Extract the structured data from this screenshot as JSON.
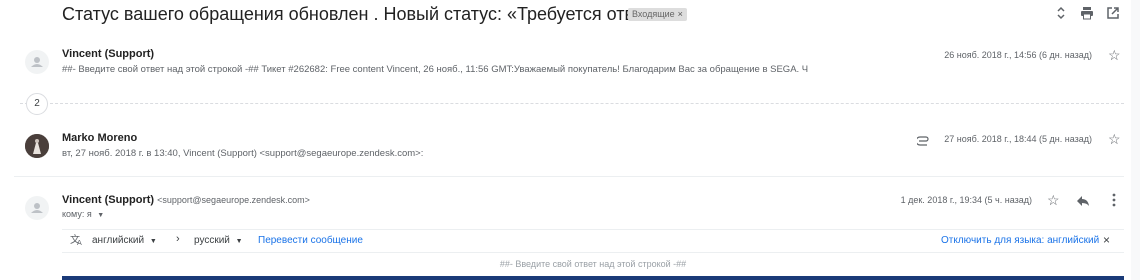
{
  "thread": {
    "subject": "Статус вашего обращения обновлен . Новый статус: «Требуется ответ».",
    "label": "Входящие",
    "label_close": "×",
    "header_icons": [
      "expand-collapse-icon",
      "print-icon",
      "open-in-new-window-icon"
    ]
  },
  "messages": [
    {
      "sender": "Vincent (Support)",
      "snippet": "##- Введите свой ответ над этой строкой -## Тикет #262682: Free content Vincent, 26 нояб., 11:56 GMT:Уважаемый покупатель! Благодарим Вас за обращение в SEGA. Ч",
      "date": "26 нояб. 2018 г., 14:56 (6 дн. назад)"
    },
    {
      "sender": "Marko Moreno",
      "snippet": "вт, 27 нояб. 2018 г. в 13:40, Vincent (Support) <support@segaeurope.zendesk.com>:",
      "date": "27 нояб. 2018 г., 18:44 (5 дн. назад)"
    },
    {
      "sender": "Vincent (Support)",
      "email": "<support@segaeurope.zendesk.com>",
      "to": "кому: я",
      "date": "1 дек. 2018 г., 19:34 (5 ч. назад)"
    }
  ],
  "collapsed_count": "2",
  "translate": {
    "from_lang": "английский",
    "arrow": "›",
    "to_lang": "русский",
    "translate_link": "Перевести сообщение",
    "disable_link": "Отключить для языка: английский",
    "close": "×"
  },
  "body_preview": "##- Введите свой ответ над этой строкой -##",
  "colors": {
    "accent": "#1a73e8",
    "text_secondary": "#5f6368",
    "body_bar": "#1a3a78"
  }
}
